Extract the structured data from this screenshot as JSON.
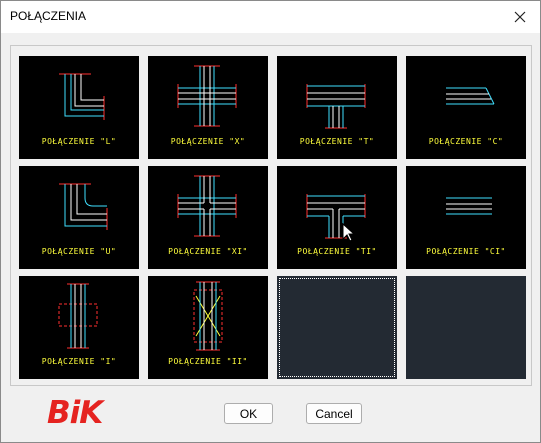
{
  "window": {
    "title": "POŁĄCZENIA"
  },
  "tiles": [
    {
      "caption": "POŁĄCZENIE \"L\""
    },
    {
      "caption": "POŁĄCZENIE \"X\""
    },
    {
      "caption": "POŁĄCZENIE \"T\""
    },
    {
      "caption": "POŁĄCZENIE \"C\""
    },
    {
      "caption": "POŁĄCZENIE \"U\""
    },
    {
      "caption": "POŁĄCZENIE \"XI\""
    },
    {
      "caption": "POŁĄCZENIE \"TI\""
    },
    {
      "caption": "POŁĄCZENIE \"CI\""
    },
    {
      "caption": "POŁĄCZENIE \"I\""
    },
    {
      "caption": "POŁĄCZENIE \"II\""
    }
  ],
  "logo": "BiK",
  "buttons": {
    "ok": "OK",
    "cancel": "Cancel"
  },
  "colors": {
    "tile_bg": "#000000",
    "empty_tile_bg": "#232a33",
    "caption": "#ffff3c",
    "cyan_line": "#40e0ff",
    "red_line": "#ff3030",
    "logo": "#e52320"
  }
}
